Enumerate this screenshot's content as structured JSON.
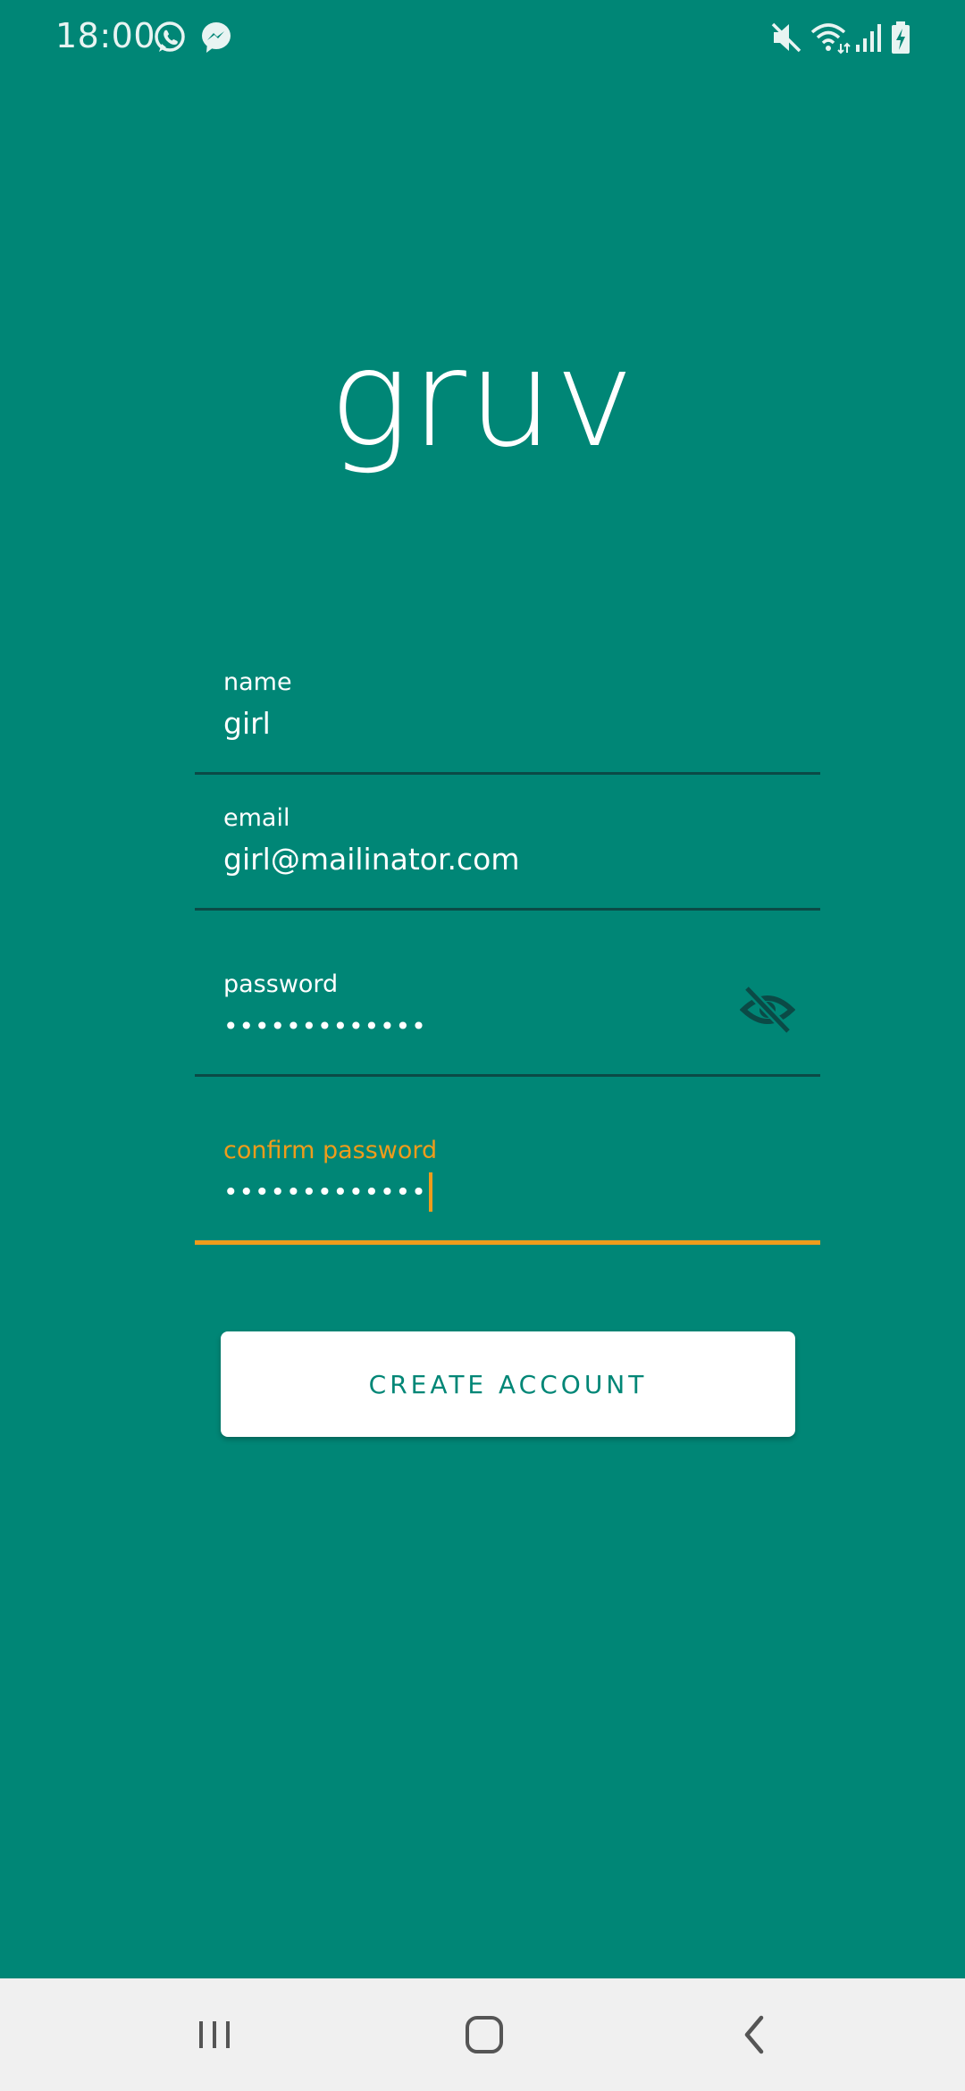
{
  "status_bar": {
    "time": "18:00",
    "left_icons": [
      "whatsapp-icon",
      "messenger-icon"
    ],
    "right_icons": [
      "mute-icon",
      "wifi-icon",
      "signal-icon",
      "battery-charging-icon"
    ]
  },
  "app": {
    "logo_text": "gruv"
  },
  "form": {
    "name": {
      "label": "name",
      "value": "girl"
    },
    "email": {
      "label": "email",
      "value": "girl@mailinator.com"
    },
    "password": {
      "label": "password",
      "value": "•••••••••••••",
      "visibility_icon": "eye-off-icon"
    },
    "confirm_password": {
      "label": "confirm password",
      "value": "•••••••••••••",
      "focused": true
    }
  },
  "actions": {
    "create_account_label": "CREATE ACCOUNT"
  },
  "nav_bar": {
    "buttons": [
      "recent-apps-icon",
      "home-icon",
      "back-icon"
    ]
  },
  "colors": {
    "background": "#008676",
    "accent": "#ef9c1b",
    "underline": "#0b4a46",
    "button_bg": "#ffffff",
    "button_text": "#008676",
    "nav_bg": "#f0f0f0"
  }
}
